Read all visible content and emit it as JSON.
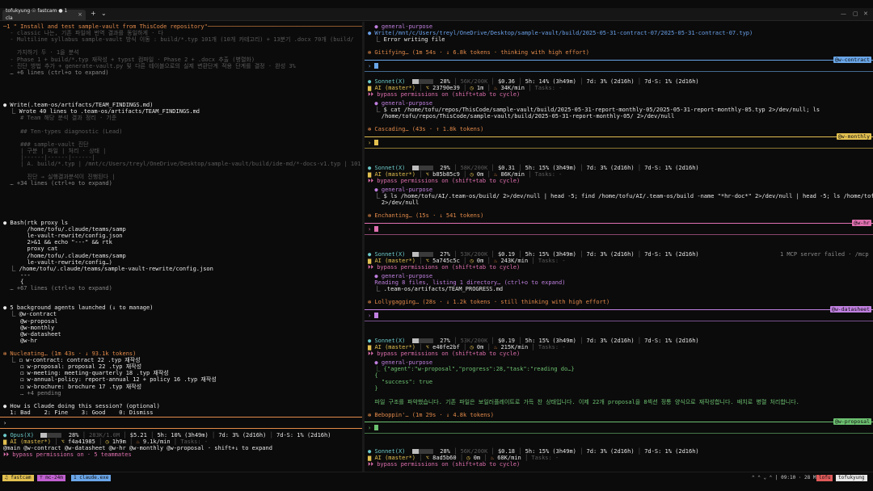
{
  "window": {
    "tab_title": "tofukyung ☉ fastcam ● 1 cla",
    "tab_close": "×",
    "new_tab": "+",
    "tab_menu": "⌄",
    "controls": [
      "—",
      "▢",
      "✕"
    ]
  },
  "left_pane": {
    "lines": [
      {
        "t": "─1 \" Install and test sample-vault from ThisCode repository\"────────────────────────────────────────────────────────────",
        "c": "o"
      },
      {
        "t": "  - classic 나는, 기존 파일에 번역 결과를 동일하게 · 다",
        "c": "d"
      },
      {
        "t": "  - Multiline syllabus sample-vault 방식 이동 : build/*.typ 101개 (10개 카테고리) + 13분기 .docx 70개 (build/",
        "c": "d"
      },
      {
        "t": "",
        "c": "d"
      },
      {
        "t": "    가치하기 두 · 1을 분석",
        "c": "d"
      },
      {
        "t": "  - Phase 1 + build/*.typ 재작성 + typst 컴파일 · Phase 2 + .docx 추출 (병렬화)",
        "c": "d"
      },
      {
        "t": "  - 진단 방법 추가 + generate-vault.py 및 다른 테이블으로의 실제 변환단계 적용 단계를 결정 · 완성 3%",
        "c": "d"
      },
      {
        "t": "  … +6 lines (ctrl+o to expand)",
        "c": "g"
      },
      {
        "t": "",
        "c": "d"
      },
      {
        "t": "",
        "c": "d"
      },
      {
        "t": "",
        "c": "d"
      },
      {
        "t": "",
        "c": "d"
      },
      {
        "t": "● Write(.team-os/artifacts/TEAM_FINDINGS.md)",
        "c": "w"
      },
      {
        "t": "  ⎿ Wrote 40 lines to .team-os/artifacts/TEAM_FINDINGS.md",
        "c": "w"
      },
      {
        "t": "     # Team 해당 분석 결과 정리 · 기준",
        "c": "d"
      },
      {
        "t": "",
        "c": "d"
      },
      {
        "t": "     ## Ten-types diagnostic (Lead)",
        "c": "d"
      },
      {
        "t": "",
        "c": "d"
      },
      {
        "t": "     ### sample-vault 진단",
        "c": "d"
      },
      {
        "t": "     | 구분 | 파일 | 처리 · 상태 |",
        "c": "d"
      },
      {
        "t": "     |------|------|------|",
        "c": "d"
      },
      {
        "t": "     | A. build/*.typ | /mnt/c/Users/treyl/OneDrive/Desktop/sample-vault/build/ide-md/*-docs-v1.typ | 101 |",
        "c": "d"
      },
      {
        "t": "",
        "c": "d"
      },
      {
        "t": "       진단 → 실행결과분석이 진행된다 |",
        "c": "d"
      },
      {
        "t": "  … +34 lines (ctrl+o to expand)",
        "c": "g"
      },
      {
        "t": "",
        "c": "d"
      },
      {
        "t": "",
        "c": "d"
      },
      {
        "t": "",
        "c": "d"
      },
      {
        "t": "",
        "c": "d"
      },
      {
        "t": "",
        "c": "d"
      },
      {
        "t": "● Bash(rtk proxy ls",
        "c": "w"
      },
      {
        "t": "       /home/tofu/.claude/teams/samp",
        "c": "w"
      },
      {
        "t": "       le-vault-rewrite/config.json",
        "c": "w"
      },
      {
        "t": "       2>&1 && echo \"---\" && rtk",
        "c": "w"
      },
      {
        "t": "       proxy cat",
        "c": "w"
      },
      {
        "t": "       /home/tofu/.claude/teams/samp",
        "c": "w"
      },
      {
        "t": "       le-vault-rewrite/config…)",
        "c": "w"
      },
      {
        "t": "  ⎿ /home/tofu/.claude/teams/sample-vault-rewrite/config.json",
        "c": "w"
      },
      {
        "t": "     ---",
        "c": "w"
      },
      {
        "t": "     {",
        "c": "w"
      },
      {
        "t": "  … +67 lines (ctrl+o to expand)",
        "c": "g"
      },
      {
        "t": "",
        "c": "d"
      },
      {
        "t": "",
        "c": "d"
      },
      {
        "t": "● 5 background agents launched (↓ to manage)",
        "c": "w"
      },
      {
        "t": "  ⎿ @w-contract",
        "c": "w"
      },
      {
        "t": "     @w-proposal",
        "c": "w"
      },
      {
        "t": "     @w-monthly",
        "c": "w"
      },
      {
        "t": "     @w-datasheet",
        "c": "w"
      },
      {
        "t": "     @w-hr",
        "c": "w"
      },
      {
        "t": "",
        "c": "d"
      },
      {
        "t": "✻ Nucleating… (1m 43s · ↓ 93.1k tokens)",
        "c": "o"
      },
      {
        "t": "  ⎿ ◻ w-contract: contract 22 .typ 재작성",
        "c": "w"
      },
      {
        "t": "     ◻ w-proposal: proposal 22 .typ 재작성",
        "c": "w"
      },
      {
        "t": "     ◻ w-meeting: meeting-quarterly 18 .typ 재작성",
        "c": "w"
      },
      {
        "t": "     ◻ w-annual-policy: report-annual 12 + policy 16 .typ 재작성",
        "c": "w"
      },
      {
        "t": "     ◻ w-brochure: brochure 17 .typ 재작성",
        "c": "w"
      },
      {
        "t": "     … +4 pending",
        "c": "g"
      },
      {
        "t": "",
        "c": "d"
      },
      {
        "t": "● How is Claude doing this session? (optional)",
        "c": "w"
      },
      {
        "t": "  1: Bad    2: Fine    3: Good    0: Dismiss",
        "c": "w"
      }
    ],
    "prompt": "›",
    "status": {
      "model": "Opus(X)",
      "pct": "28%",
      "tokens": "283K/1.0M",
      "cost": "$5.21",
      "h5": "5h: 10% (3h49m)",
      "d7": "7d: 3% (2d16h)",
      "d7s": "7d-S: 1% (2d16h)",
      "branch": "AI (master*)",
      "commit": "f4a41985",
      "time": "1h9m",
      "rate": "9.1k/min",
      "tasks": "Tasks: -",
      "agents_line": "@main @w-contract @w-datasheet @w-hr @w-monthly @w-proposal · shift+↓ to expand",
      "bypass": "⏵⏵ bypass permissions on · 5 teammates"
    }
  },
  "right_pane": {
    "sections": [
      {
        "lines": [
          {
            "t": "  ● general-purpose",
            "c": "p"
          },
          {
            "t": "● Write(/mnt/c/Users/treyl/OneDrive/Desktop/sample-vault/build/2025-05-31-contract-07/2025-05-31-contract-07.typ)",
            "c": "b"
          },
          {
            "t": "  ⎿ Error writing file",
            "c": "w"
          },
          {
            "t": "",
            "c": "d"
          },
          {
            "t": "✻ Gitifying… (1m 54s · ↓ 6.8k tokens · thinking with high effort)",
            "c": "o"
          }
        ],
        "label": "@w-contract",
        "color": "#6aa6e8"
      },
      {
        "status": {
          "model": "Sonnet(X)",
          "pct": "28%",
          "tokens": "56K/200K",
          "cost": "$0.36",
          "h5": "5h: 14% (3h49m)",
          "d7": "7d: 3% (2d16h)",
          "d7s": "7d-S: 1% (2d16h)",
          "branch": "AI (master*)",
          "commit": "23790e39",
          "time": "1m",
          "rate": "34K/min",
          "tasks": "Tasks: -",
          "bypass": "⏵⏵ bypass permissions on (shift+tab to cycle)"
        },
        "lines": [
          {
            "t": "  ● general-purpose",
            "c": "p"
          },
          {
            "t": "  ⎿ $ cat /home/tofu/repos/ThisCode/sample-vault/build/2025-05-31-report-monthly-05/2025-05-31-report-monthly-05.typ 2>/dev/null; ls",
            "c": "w"
          },
          {
            "t": "    /home/tofu/repos/ThisCode/sample-vault/build/2025-05-31-report-monthly-05/ 2>/dev/null",
            "c": "w"
          },
          {
            "t": "",
            "c": "d"
          },
          {
            "t": "✻ Cascading… (43s · ↑ 1.8k tokens)",
            "c": "o"
          }
        ],
        "label": "@w-monthly",
        "color": "#e2c050"
      },
      {
        "status": {
          "model": "Sonnet(X)",
          "pct": "29%",
          "tokens": "58K/200K",
          "cost": "$0.31",
          "h5": "5h: 15% (3h49m)",
          "d7": "7d: 3% (2d16h)",
          "d7s": "7d-S: 1% (2d16h)",
          "branch": "AI (master*)",
          "commit": "b85b85c9",
          "time": "0m",
          "rate": "86K/min",
          "tasks": "Tasks: -",
          "bypass": "⏵⏵ bypass permissions on (shift+tab to cycle)"
        },
        "lines": [
          {
            "t": "  ● general-purpose",
            "c": "p"
          },
          {
            "t": "  ⎿ $ ls /home/tofu/AI/.team-os/build/ 2>/dev/null | head -5; find /home/tofu/AI/.team-os/build -name \"*hr-doc*\" 2>/dev/null | head -5; ls /home/tofu/AI/.team-os/",
            "c": "w"
          },
          {
            "t": "    2>/dev/null",
            "c": "w"
          },
          {
            "t": "",
            "c": "d"
          },
          {
            "t": "✻ Enchanting… (15s · ↓ 541 tokens)",
            "c": "o"
          }
        ],
        "label": "@w-hr",
        "color": "#e070b0"
      },
      {
        "status": {
          "model": "Sonnet(X)",
          "pct": "27%",
          "tokens": "53K/200K",
          "cost": "$0.19",
          "h5": "5h: 15% (3h49m)",
          "d7": "7d: 3% (2d16h)",
          "d7s": "7d-S: 1% (2d16h)",
          "branch": "AI (master*)",
          "commit": "5a745c5c",
          "time": "0m",
          "rate": "243K/min",
          "tasks": "Tasks: -",
          "bypass": "⏵⏵ bypass permissions on (shift+tab to cycle)",
          "extra": "1 MCP server failed · /mcp"
        },
        "lines": [
          {
            "t": "  ● general-purpose",
            "c": "p"
          },
          {
            "t": "  Reading 8 files, listing 1 directory… (ctrl+o to expand)",
            "c": "p"
          },
          {
            "t": "  ⎿ .team-os/artifacts/TEAM_PROGRESS.md",
            "c": "w"
          },
          {
            "t": "",
            "c": "d"
          },
          {
            "t": "✻ Lollygagging… (28s · ↓ 1.2k tokens · still thinking with high effort)",
            "c": "o"
          }
        ],
        "label": "@w-datasheet",
        "color": "#c080e0"
      },
      {
        "status": {
          "model": "Sonnet(X)",
          "pct": "27%",
          "tokens": "53K/200K",
          "cost": "$0.19",
          "h5": "5h: 15% (3h49m)",
          "d7": "7d: 3% (2d16h)",
          "d7s": "7d-S: 1% (2d16h)",
          "branch": "AI (master*)",
          "commit": "e40fe2bf",
          "time": "0m",
          "rate": "215K/min",
          "tasks": "Tasks: -",
          "bypass": "⏵⏵ bypass permissions on (shift+tab to cycle)"
        },
        "lines": [
          {
            "t": "  ● general-purpose",
            "c": "p"
          },
          {
            "t": "  ⎿ {\"agent\":\"w-proposal\",\"progress\":28,\"task\":\"reading do…}",
            "c": "gr"
          },
          {
            "t": "  {",
            "c": "gr"
          },
          {
            "t": "    \"success\": true",
            "c": "gr"
          },
          {
            "t": "  }",
            "c": "gr"
          },
          {
            "t": "",
            "c": "d"
          },
          {
            "t": "  파일 구조를 파악했습니다. 기존 파일은 보일러플레이트로 가득 찬 상태입니다. 이제 22개 proposal을 8섹션 정통 양식으로 재작성합니다. 배치로 병렬 처리합니다.",
            "c": "gr"
          },
          {
            "t": "",
            "c": "d"
          },
          {
            "t": "✻ Beboppin'… (1m 29s · ↓ 4.8k tokens)",
            "c": "o"
          }
        ],
        "label": "@w-proposal",
        "color": "#6cc070"
      },
      {
        "status": {
          "model": "Sonnet(X)",
          "pct": "28%",
          "tokens": "56K/200K",
          "cost": "$0.18",
          "h5": "5h: 15% (3h49m)",
          "d7": "7d: 3% (2d16h)",
          "d7s": "7d-S: 1% (2d16h)",
          "branch": "AI (master*)",
          "commit": "8ad5b60",
          "time": "0m",
          "rate": "68K/min",
          "tasks": "Tasks: -",
          "bypass": "⏵⏵ bypass permissions on (shift+tab to cycle)"
        },
        "lines": [],
        "label": "",
        "color": ""
      }
    ]
  },
  "statusbar": {
    "items": [
      {
        "t": "♫ fastcam",
        "bg": "#e2c050"
      },
      {
        "t": "⊤ mc-24m",
        "bg": "#c060d0"
      },
      {
        "t": "1 claude.exe",
        "bg": "#6aa6e8"
      }
    ],
    "right": "⌃ ⌃ ⌄ ⌃ | 09:10 · 28 May",
    "badge": "tofukyung",
    "badge2": "lofu"
  }
}
